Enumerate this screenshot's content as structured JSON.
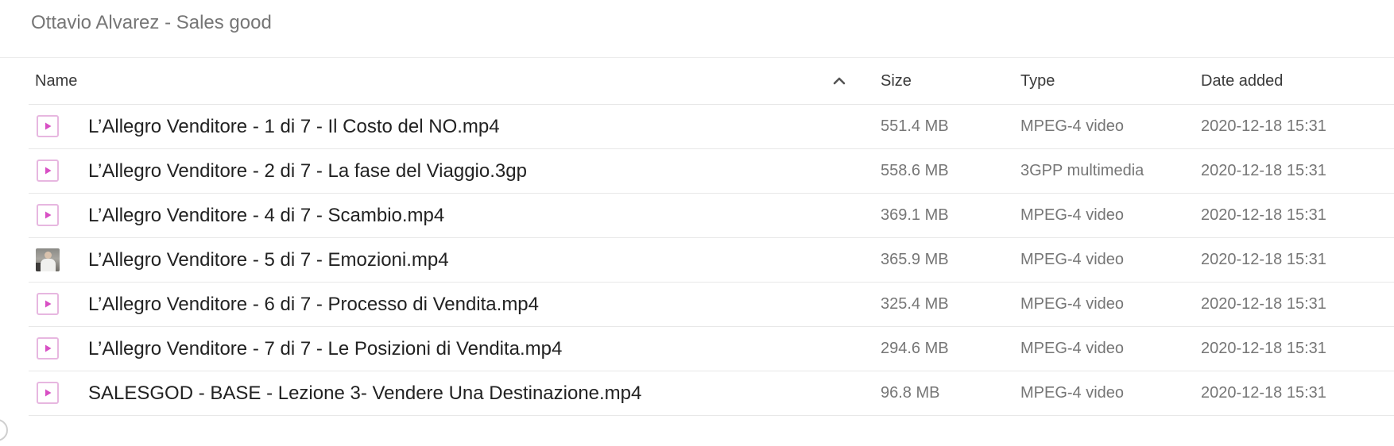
{
  "breadcrumb": "Ottavio Alvarez - Sales good",
  "columns": {
    "name": "Name",
    "size": "Size",
    "type": "Type",
    "date": "Date added"
  },
  "sort": {
    "column": "Name",
    "direction": "ascending",
    "icon": "chevron-up-icon"
  },
  "colors": {
    "video_icon_border": "#e7b7e0",
    "video_icon_play": "#d84fc4",
    "text_muted": "#767676"
  },
  "files": [
    {
      "name": "L’Allegro Venditore - 1 di 7 - Il Costo del NO.mp4",
      "size": "551.4 MB",
      "type": "MPEG-4 video",
      "date": "2020-12-18 15:31",
      "icon": "video-file-icon"
    },
    {
      "name": "L’Allegro Venditore - 2 di 7 - La fase del Viaggio.3gp",
      "size": "558.6 MB",
      "type": "3GPP multimedia",
      "date": "2020-12-18 15:31",
      "icon": "video-file-icon"
    },
    {
      "name": "L’Allegro Venditore - 4 di 7 - Scambio.mp4",
      "size": "369.1 MB",
      "type": "MPEG-4 video",
      "date": "2020-12-18 15:31",
      "icon": "video-file-icon"
    },
    {
      "name": "L’Allegro Venditore - 5 di 7 - Emozioni.mp4",
      "size": "365.9 MB",
      "type": "MPEG-4 video",
      "date": "2020-12-18 15:31",
      "icon": "video-thumbnail"
    },
    {
      "name": "L’Allegro Venditore - 6 di 7 - Processo di Vendita.mp4",
      "size": "325.4 MB",
      "type": "MPEG-4 video",
      "date": "2020-12-18 15:31",
      "icon": "video-file-icon"
    },
    {
      "name": "L’Allegro Venditore - 7 di 7 - Le Posizioni di Vendita.mp4",
      "size": "294.6 MB",
      "type": "MPEG-4 video",
      "date": "2020-12-18 15:31",
      "icon": "video-file-icon"
    },
    {
      "name": "SALESGOD - BASE - Lezione 3- Vendere Una Destinazione.mp4",
      "size": "96.8 MB",
      "type": "MPEG-4 video",
      "date": "2020-12-18 15:31",
      "icon": "video-file-icon"
    }
  ]
}
